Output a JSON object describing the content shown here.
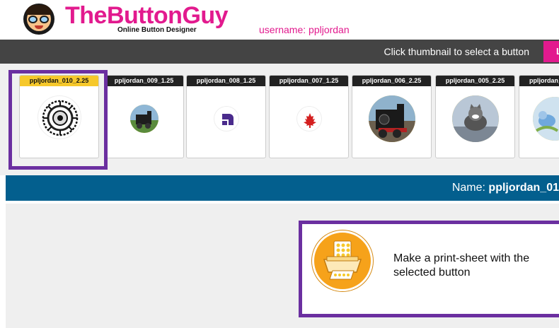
{
  "header": {
    "brand": "TheButtonGuy",
    "tagline": "Online Button Designer",
    "username_label": "username: ppljordan"
  },
  "toolbar": {
    "instruction": "Click thumbnail to select a button",
    "pink_button_label": "L"
  },
  "thumbnails": [
    {
      "label": "ppljordan_010_2.25",
      "selected": true,
      "image": "mandala-icon"
    },
    {
      "label": "ppljordan_009_1.25",
      "selected": false,
      "image": "train-photo"
    },
    {
      "label": "ppljordan_008_1.25",
      "selected": false,
      "image": "purple-logo-icon"
    },
    {
      "label": "ppljordan_007_1.25",
      "selected": false,
      "image": "maple-leaf-icon"
    },
    {
      "label": "ppljordan_006_2.25",
      "selected": false,
      "image": "train-photo"
    },
    {
      "label": "ppljordan_005_2.25",
      "selected": false,
      "image": "kitten-photo"
    },
    {
      "label": "ppljordan_",
      "selected": false,
      "image": "bird-photo"
    }
  ],
  "namebar": {
    "prefix": "Name: ",
    "value": "ppljordan_01"
  },
  "print_sheet": {
    "text": "Make a print-sheet with the selected button",
    "icon": "printer-icon"
  },
  "colors": {
    "brand_pink": "#e21a8e",
    "toolbar_bg": "#444444",
    "namebar_bg": "#035f8e",
    "selection_purple": "#6b2fa0",
    "selected_label_yellow": "#f6c82b",
    "print_icon_orange": "#f6a21a"
  }
}
